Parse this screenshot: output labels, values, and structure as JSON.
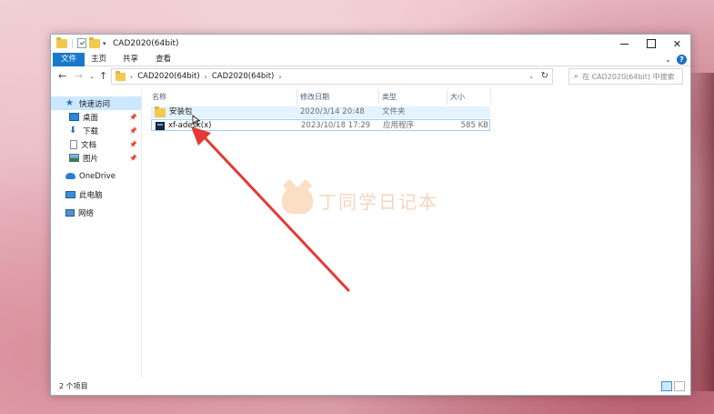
{
  "window": {
    "title": "CAD2020(64bit)",
    "controls": {
      "minimize": "",
      "maximize": "",
      "close": "✕"
    }
  },
  "ribbon": {
    "tabs": [
      "文件",
      "主页",
      "共享",
      "查看"
    ],
    "expand_icon": "chevron-down-icon",
    "help": "?"
  },
  "address_bar": {
    "crumbs": [
      "CAD2020(64bit)",
      "CAD2020(64bit)"
    ],
    "search_placeholder": "在 CAD2020(64bit) 中搜索"
  },
  "nav_pane": {
    "quick_access": "快速访问",
    "items": [
      "桌面",
      "下载",
      "文档",
      "图片"
    ],
    "onedrive": "OneDrive",
    "this_pc": "此电脑",
    "network": "网络"
  },
  "columns": {
    "name": "名称",
    "modified": "修改日期",
    "type": "类型",
    "size": "大小"
  },
  "files": [
    {
      "name": "安装包",
      "modified": "2020/3/14 20:48",
      "type": "文件夹",
      "size": "",
      "icon": "folder-icon"
    },
    {
      "name": "xf-adesk.exe",
      "modified": "2023/10/18 17:29",
      "type": "应用程序",
      "size": "585 KB",
      "icon": "exe-icon"
    }
  ],
  "file_name_display": [
    "安装包",
    "xf-adesk(x)"
  ],
  "status": {
    "item_count": "2 个项目"
  },
  "watermark": {
    "text": "丁同学日记本"
  },
  "colors": {
    "accent": "#1979ca",
    "selection": "#cce8ff",
    "arrow": "#e53935"
  }
}
